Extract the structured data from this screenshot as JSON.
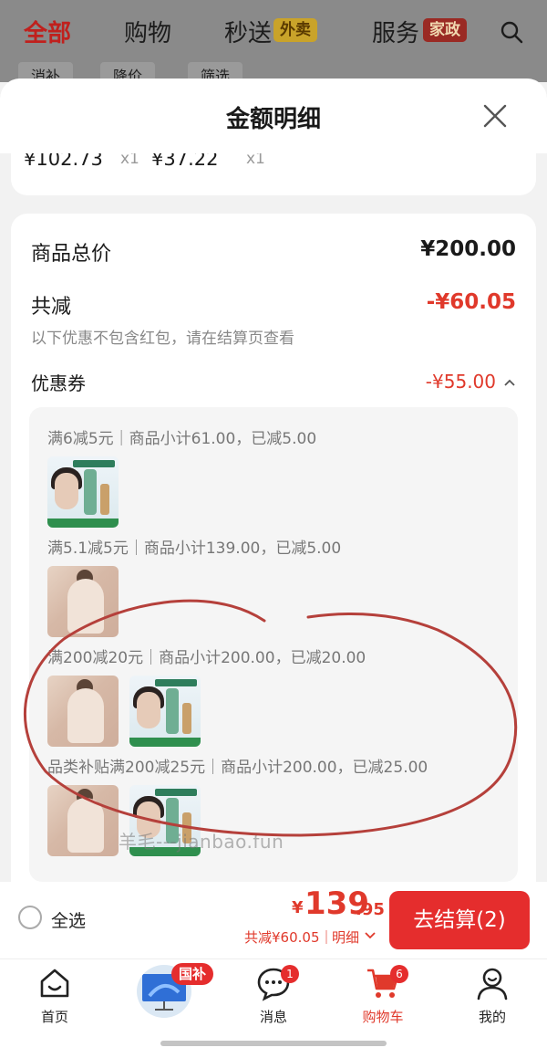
{
  "top_nav": {
    "tabs": [
      {
        "label": "全部"
      },
      {
        "label": "购物"
      },
      {
        "label": "秒送"
      },
      {
        "label": "服务"
      }
    ],
    "badges": {
      "waimai": "外卖",
      "jiazheng": "家政"
    },
    "filter_chips": [
      "消补",
      "降价",
      "筛选"
    ]
  },
  "modal": {
    "title": "金额明细",
    "items": [
      {
        "price": "¥102.73",
        "qty": "x1"
      },
      {
        "price": "¥37.22",
        "qty": "x1"
      }
    ],
    "total_label": "商品总价",
    "total_value": "¥200.00",
    "reduce_label": "共减",
    "reduce_value": "-¥60.05",
    "reduce_note": "以下优惠不包含红包，请在结算页查看",
    "coupon_label": "优惠券",
    "coupon_value": "-¥55.00",
    "coupon_groups": [
      {
        "text": "满6减5元｜商品小计61.00，已减5.00",
        "thumbs": [
          "oil"
        ]
      },
      {
        "text": "满5.1减5元｜商品小计139.00，已减5.00",
        "thumbs": [
          "pajama"
        ]
      },
      {
        "text": "满200减20元｜商品小计200.00，已减20.00",
        "thumbs": [
          "pajama",
          "oil"
        ]
      },
      {
        "text": "品类补贴满200减25元｜商品小计200.00，已减25.00",
        "thumbs": [
          "pajama",
          "oil"
        ]
      }
    ],
    "watermark": "羊毛---jianbao.fun"
  },
  "checkout": {
    "select_all": "全选",
    "currency": "¥",
    "total_integer": "139",
    "total_decimal": ".95",
    "saved": "共减¥60.05｜",
    "detail": "明细",
    "button": "去结算(2)"
  },
  "tab_bar": {
    "tabs": [
      {
        "label": "首页",
        "icon": "home-icon"
      },
      {
        "label": "",
        "icon": "promo-icon"
      },
      {
        "label": "消息",
        "icon": "message-icon",
        "badge": "1"
      },
      {
        "label": "购物车",
        "icon": "cart-icon",
        "badge": "6"
      },
      {
        "label": "我的",
        "icon": "profile-icon"
      }
    ],
    "promo_badge": "国补"
  },
  "colors": {
    "accent": "#e52d2d",
    "price_red": "#e0392b",
    "dim_overlay": "#8a8a8a"
  }
}
